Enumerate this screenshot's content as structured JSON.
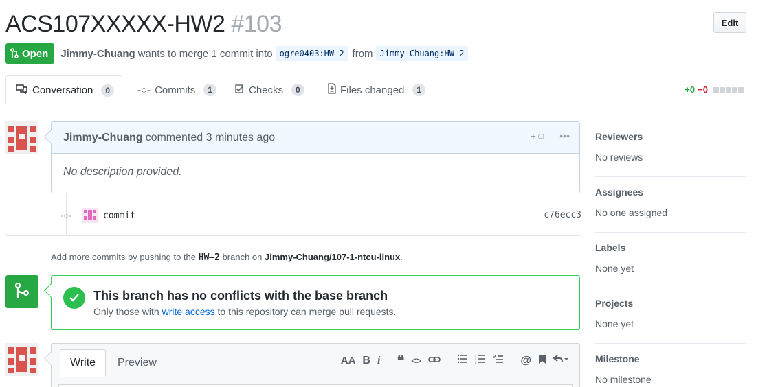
{
  "header": {
    "title": "ACS107XXXXX-HW2",
    "number": "#103",
    "edit_label": "Edit"
  },
  "meta": {
    "state": "Open",
    "author": "Jimmy-Chuang",
    "merge_text": "wants to merge 1 commit into",
    "base_branch": "ogre0403:HW-2",
    "from_text": "from",
    "head_branch": "Jimmy-Chuang:HW-2"
  },
  "tabs": [
    {
      "label": "Conversation",
      "count": "0"
    },
    {
      "label": "Commits",
      "count": "1"
    },
    {
      "label": "Checks",
      "count": "0"
    },
    {
      "label": "Files changed",
      "count": "1"
    }
  ],
  "diffstat": {
    "additions": "+0",
    "deletions": "−0"
  },
  "comment": {
    "author": "Jimmy-Chuang",
    "action": "commented 3 minutes ago",
    "body": "No description provided."
  },
  "commit": {
    "message": "commit",
    "sha": "c76ecc3"
  },
  "push_note": {
    "prefix": "Add more commits by pushing to the",
    "branch": "HW–2",
    "middle": "branch on",
    "repo": "Jimmy-Chuang/107-1-ntcu-linux",
    "suffix": "."
  },
  "merge": {
    "title": "This branch has no conflicts with the base branch",
    "desc_prefix": "Only those with",
    "desc_link": "write access",
    "desc_suffix": "to this repository can merge pull requests."
  },
  "editor": {
    "write_tab": "Write",
    "preview_tab": "Preview",
    "toolbar": [
      "AA",
      "B",
      "i",
      "❝",
      "<>",
      "link",
      "ul",
      "ol",
      "tasks",
      "@",
      "bookmark",
      "reply"
    ]
  },
  "sidebar": [
    {
      "heading": "Reviewers",
      "value": "No reviews"
    },
    {
      "heading": "Assignees",
      "value": "No one assigned"
    },
    {
      "heading": "Labels",
      "value": "None yet"
    },
    {
      "heading": "Projects",
      "value": "None yet"
    },
    {
      "heading": "Milestone",
      "value": "No milestone"
    }
  ],
  "colors": {
    "open": "#28a745",
    "link": "#0366d6",
    "avatar": "#d9534f"
  }
}
